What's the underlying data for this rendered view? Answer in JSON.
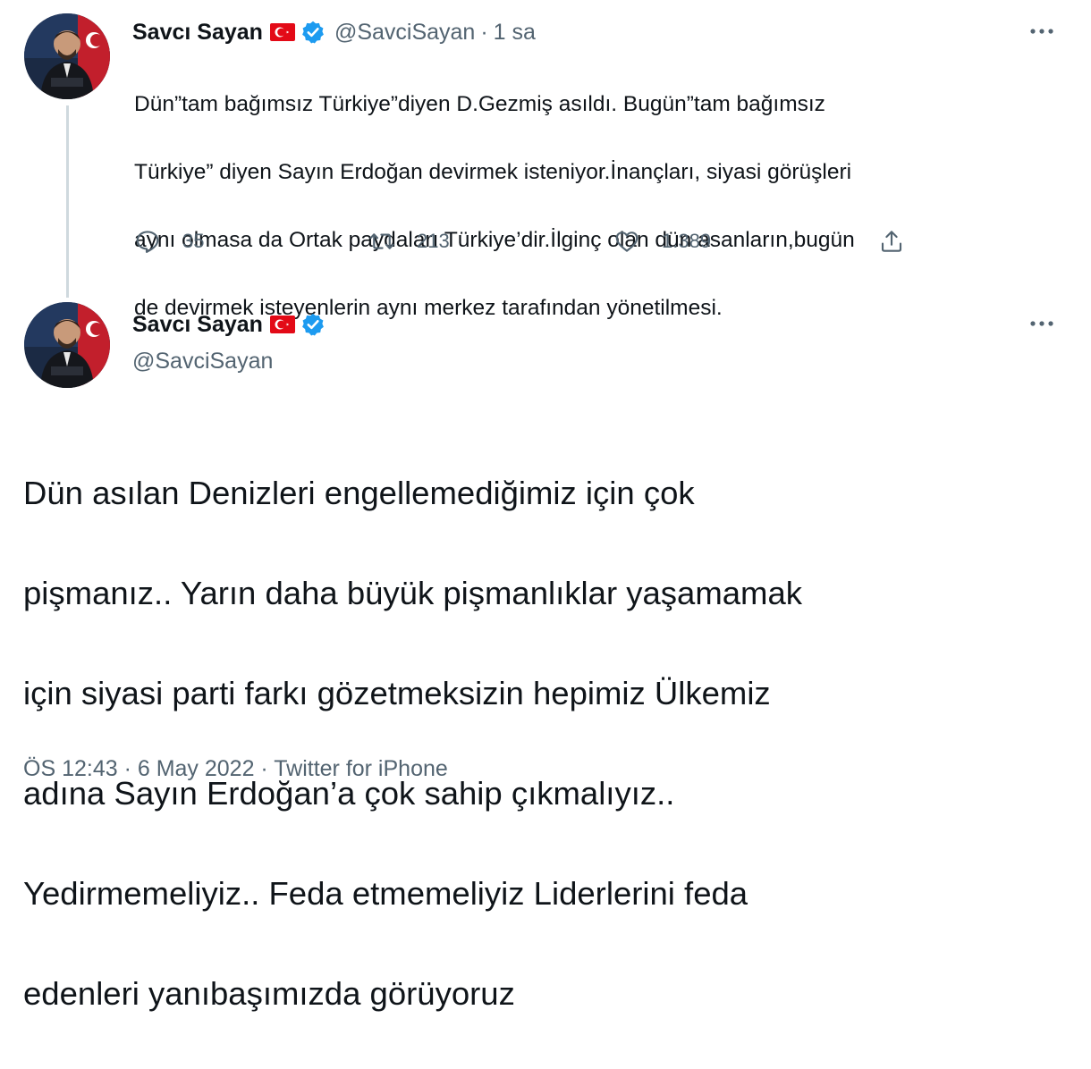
{
  "tweet1": {
    "display_name": "Savcı Sayan",
    "handle": "@SavciSayan",
    "time": "1 sa",
    "separator": "·",
    "text_lines": [
      "Dün”tam bağımsız Türkiye”diyen D.Gezmiş asıldı. Bugün”tam bağımsız",
      "Türkiye” diyen Sayın Erdoğan devirmek isteniyor.İnançları, siyasi  görüşleri",
      "aynı olmasa da Ortak paydaları Türkiye’dir.İlginç olan dün asanların,bugün",
      "de devirmek  isteyenlerin aynı merkez tarafından yönetilmesi."
    ],
    "actions": {
      "reply_count": "35",
      "retweet_count": "213",
      "like_count": "1.389"
    }
  },
  "tweet2": {
    "display_name": "Savcı Sayan",
    "handle": "@SavciSayan",
    "text_lines": [
      "Dün asılan Denizleri engellemediğimiz için çok",
      "pişmanız.. Yarın daha büyük pişmanlıklar yaşamamak",
      "için siyasi parti farkı gözetmeksizin hepimiz Ülkemiz",
      "adına Sayın Erdoğan’a çok sahip çıkmalıyız..",
      "Yedirmemeliyiz.. Feda etmemeliyiz Liderlerini feda",
      "edenleri yanıbaşımızda görüyoruz"
    ],
    "meta": "ÖS 12:43 · 6 May 2022 · Twitter for iPhone"
  },
  "icons": {
    "flag": "turkey-flag-icon",
    "verified": "verified-badge-icon",
    "more": "more-options-icon",
    "reply": "reply-icon",
    "retweet": "retweet-icon",
    "like": "like-icon",
    "share": "share-icon"
  },
  "colors": {
    "text_primary": "#0f1419",
    "text_secondary": "#536471",
    "verified_blue": "#1d9bf0",
    "flag_red": "#e30a17",
    "thread_line": "#cfd9de"
  }
}
